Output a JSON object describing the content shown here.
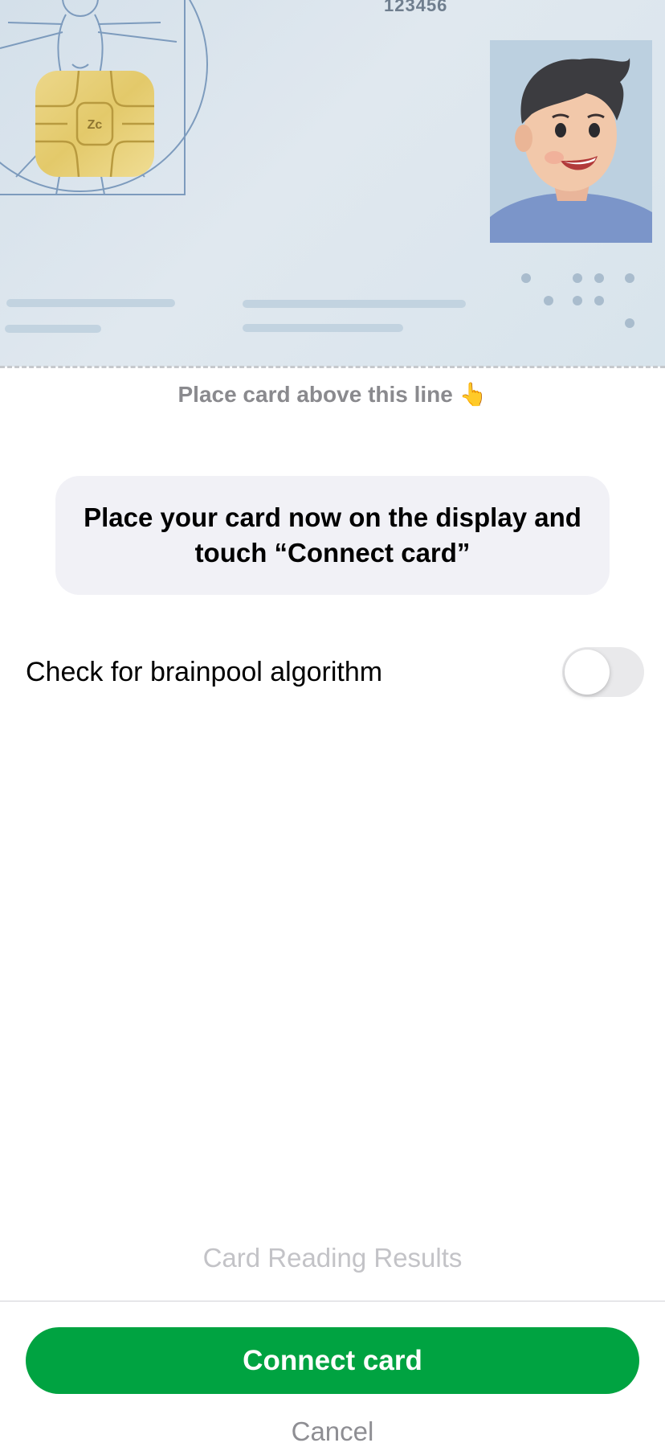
{
  "card": {
    "number": "123456",
    "chip_label": "Zc"
  },
  "hint": {
    "text": "Place card above this line",
    "emoji": "👆"
  },
  "instruction": {
    "text": "Place your card now on the display and touch “Connect card”"
  },
  "settings": {
    "brainpool_label": "Check for brainpool algorithm",
    "brainpool_enabled": false
  },
  "results_link": "Card Reading Results",
  "buttons": {
    "connect_label": "Connect card",
    "cancel_label": "Cancel"
  },
  "colors": {
    "accent": "#00a341",
    "card_bg": "#dce6ee"
  }
}
